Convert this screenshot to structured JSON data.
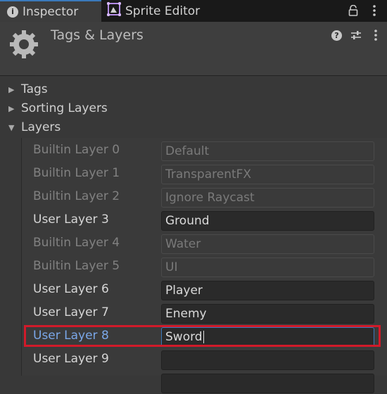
{
  "tabs": [
    {
      "label": "Inspector",
      "icon": "info-icon",
      "active": true
    },
    {
      "label": "Sprite Editor",
      "icon": "sprite-editor-icon",
      "active": false
    }
  ],
  "header": {
    "title": "Tags & Layers",
    "icon": "gear-icon"
  },
  "foldouts": [
    {
      "label": "Tags",
      "expanded": false
    },
    {
      "label": "Sorting Layers",
      "expanded": false
    },
    {
      "label": "Layers",
      "expanded": true
    }
  ],
  "layers": [
    {
      "label": "Builtin Layer 0",
      "value": "Default",
      "kind": "builtin"
    },
    {
      "label": "Builtin Layer 1",
      "value": "TransparentFX",
      "kind": "builtin"
    },
    {
      "label": "Builtin Layer 2",
      "value": "Ignore Raycast",
      "kind": "builtin"
    },
    {
      "label": "User Layer 3",
      "value": "Ground",
      "kind": "user"
    },
    {
      "label": "Builtin Layer 4",
      "value": "Water",
      "kind": "builtin"
    },
    {
      "label": "Builtin Layer 5",
      "value": "UI",
      "kind": "builtin"
    },
    {
      "label": "User Layer 6",
      "value": "Player",
      "kind": "user"
    },
    {
      "label": "User Layer 7",
      "value": "Enemy",
      "kind": "user"
    },
    {
      "label": "User Layer 8",
      "value": "Sword",
      "kind": "editing"
    },
    {
      "label": "User Layer 9",
      "value": "",
      "kind": "user"
    }
  ],
  "colors": {
    "accent": "#3a79bb",
    "highlight": "#d11a2a"
  }
}
